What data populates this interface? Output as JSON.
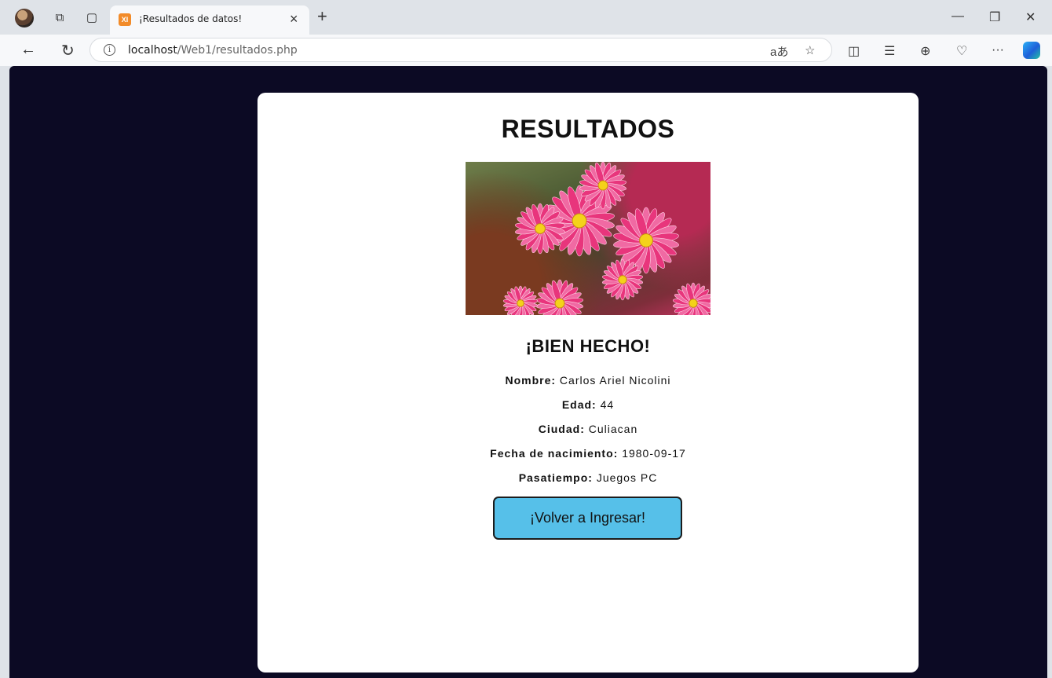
{
  "browser": {
    "tab_title": "¡Resultados de datos!",
    "favicon_text": "XI",
    "url_host": "localhost",
    "url_path": "/Web1/resultados.php"
  },
  "page": {
    "title": "RESULTADOS",
    "subtitle": "¡BIEN HECHO!",
    "fields": [
      {
        "label": "Nombre:",
        "value": "Carlos Ariel Nicolini"
      },
      {
        "label": "Edad:",
        "value": "44"
      },
      {
        "label": "Ciudad:",
        "value": "Culiacan"
      },
      {
        "label": "Fecha de nacimiento:",
        "value": "1980-09-17"
      },
      {
        "label": "Pasatiempo:",
        "value": "Juegos PC"
      }
    ],
    "button_label": "¡Volver a Ingresar!",
    "image_alt": "pink-daisy-flowers"
  },
  "colors": {
    "background": "#0c0a24",
    "card": "#ffffff",
    "button": "#56c0e9"
  }
}
